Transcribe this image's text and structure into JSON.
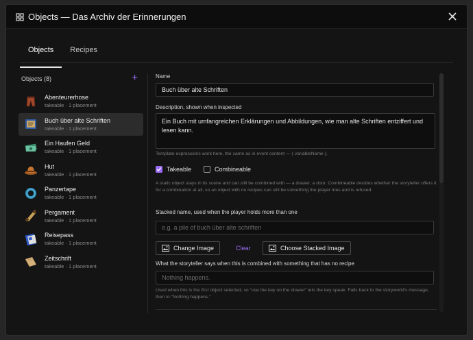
{
  "window": {
    "title": "Objects — Das Archiv der Erinnerungen"
  },
  "tabs": [
    {
      "label": "Objects",
      "active": true
    },
    {
      "label": "Recipes",
      "active": false
    }
  ],
  "sidebar": {
    "header": "Objects (8)",
    "add_label": "+",
    "items": [
      {
        "name": "Abenteurerhose",
        "meta": "takeable · 1 placement",
        "icon": "trousers-icon"
      },
      {
        "name": "Buch über alte Schriften",
        "meta": "takeable · 1 placement",
        "icon": "book-icon",
        "selected": true
      },
      {
        "name": "Ein Haufen Geld",
        "meta": "takeable · 1 placement",
        "icon": "money-icon"
      },
      {
        "name": "Hut",
        "meta": "takeable · 1 placement",
        "icon": "hat-icon"
      },
      {
        "name": "Panzertape",
        "meta": "takeable · 1 placement",
        "icon": "tape-icon"
      },
      {
        "name": "Pergament",
        "meta": "takeable · 1 placement",
        "icon": "scroll-icon"
      },
      {
        "name": "Reisepass",
        "meta": "takeable · 1 placement",
        "icon": "passport-icon"
      },
      {
        "name": "Zeitschrift",
        "meta": "takeable · 1 placement",
        "icon": "magazine-icon"
      }
    ]
  },
  "form": {
    "name_label": "Name",
    "name_value": "Buch über alte Schriften",
    "description_label": "Description, shown when inspected",
    "description_value": "Ein Buch mit umfangreichen Erklärungen und Abbildungen, wie man alte Schriften entziffert und lesen kann.",
    "template_hint": "Template expressions work here, the same as in event content — { variableName }.",
    "takeable_label": "Takeable",
    "takeable_checked": true,
    "combineable_label": "Combineable",
    "combineable_checked": false,
    "static_hint": "A static object stays in its scene and can still be combined with — a drawer, a door. Combineable decides whether the storyteller offers it for a combination at all, so an object with no recipes can still be something the player tries and is refused.",
    "stacked_label": "Stacked name, used when the player holds more than one",
    "stacked_placeholder": "e.g. a pile of buch über alte schriften",
    "change_image_label": "Change Image",
    "clear_label": "Clear",
    "choose_stacked_label": "Choose Stacked Image",
    "fallback_label": "What the storyteller says when this is combined with something that has no recipe",
    "fallback_placeholder": "Nothing happens.",
    "fallback_hint_1": "Used when this is the",
    "fallback_hint_em": "first",
    "fallback_hint_2": "object selected, so “use the key on the drawer” lets the key speak. Falls back to the storyworld's message, then to “Nothing happens.”"
  },
  "colors": {
    "accent": "#9a6cf6",
    "background": "#141414",
    "selected_row": "#2c2c2c"
  }
}
